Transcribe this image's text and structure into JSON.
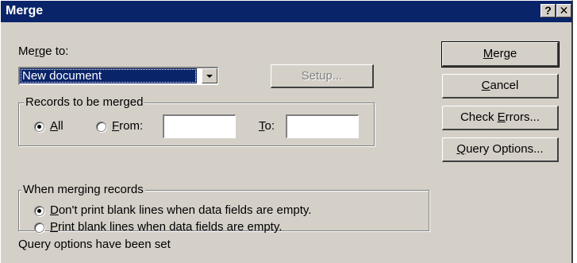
{
  "window": {
    "title": "Merge",
    "help_glyph": "?",
    "close_glyph": "✕"
  },
  "merge_to": {
    "label_pre": "Me",
    "label_key": "r",
    "label_post": "ge to:",
    "selected": "New document"
  },
  "setup_button": "Setup...",
  "records": {
    "legend": "Records to be merged",
    "all": {
      "key": "A",
      "rest": "ll",
      "selected": true
    },
    "from": {
      "key": "F",
      "rest": "rom:",
      "value": ""
    },
    "to": {
      "key": "T",
      "rest": "o:",
      "value": ""
    }
  },
  "blank_lines": {
    "legend": "When merging records",
    "option1": {
      "key": "D",
      "rest": "on't print blank lines when data fields are empty.",
      "selected": true
    },
    "option2": {
      "key": "P",
      "rest": "rint blank lines when data fields are empty.",
      "selected": false
    }
  },
  "buttons": {
    "merge": {
      "key": "M",
      "rest": "erge"
    },
    "cancel": {
      "key": "C",
      "rest": "ancel"
    },
    "check_errors": {
      "pre": "Check ",
      "key": "E",
      "rest": "rrors..."
    },
    "query_options": {
      "key": "Q",
      "rest": "uery Options..."
    }
  },
  "status_text": "Query options have been set"
}
